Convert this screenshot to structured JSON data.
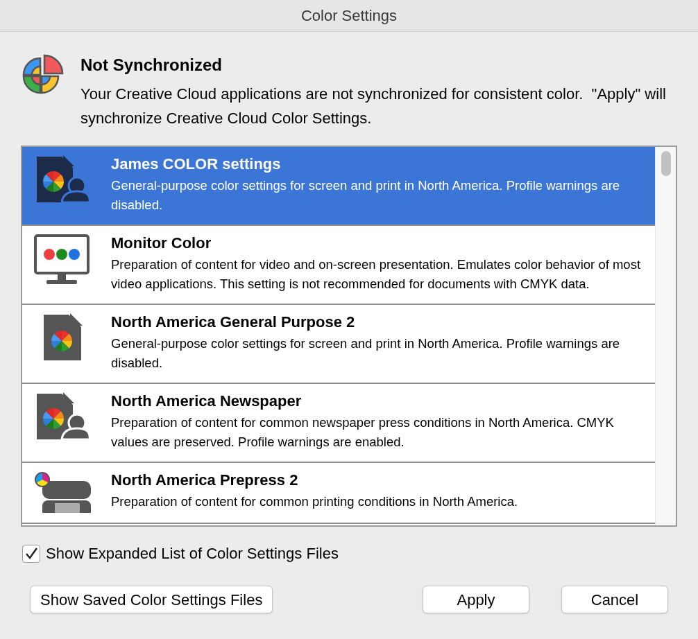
{
  "window": {
    "title": "Color Settings"
  },
  "notice": {
    "title": "Not Synchronized",
    "message": "Your Creative Cloud applications are not synchronized for consistent color.  \"Apply\" will synchronize Creative Cloud Color Settings."
  },
  "settings_list": [
    {
      "kind": "document-person",
      "title": "James COLOR settings",
      "description": "General-purpose color settings for screen and print in North America. Profile warnings are disabled.",
      "selected": true
    },
    {
      "kind": "monitor",
      "title": "Monitor Color",
      "description": "Preparation of content for video and on-screen presentation. Emulates color behavior of most video applications. This setting is not recommended for documents with CMYK data.",
      "selected": false
    },
    {
      "kind": "document",
      "title": "North America General Purpose 2",
      "description": "General-purpose color settings for screen and print in North America. Profile warnings are disabled.",
      "selected": false
    },
    {
      "kind": "document-person",
      "title": "North America Newspaper",
      "description": "Preparation of content for common newspaper press conditions in North America. CMYK values are preserved. Profile warnings are enabled.",
      "selected": false
    },
    {
      "kind": "printer",
      "title": "North America Prepress 2",
      "description": "Preparation of content for common printing conditions in North America.",
      "selected": false
    }
  ],
  "expanded_list_checkbox": {
    "label": "Show Expanded List of Color Settings Files",
    "checked": true
  },
  "buttons": {
    "show_saved": "Show Saved Color Settings Files",
    "apply": "Apply",
    "cancel": "Cancel"
  }
}
